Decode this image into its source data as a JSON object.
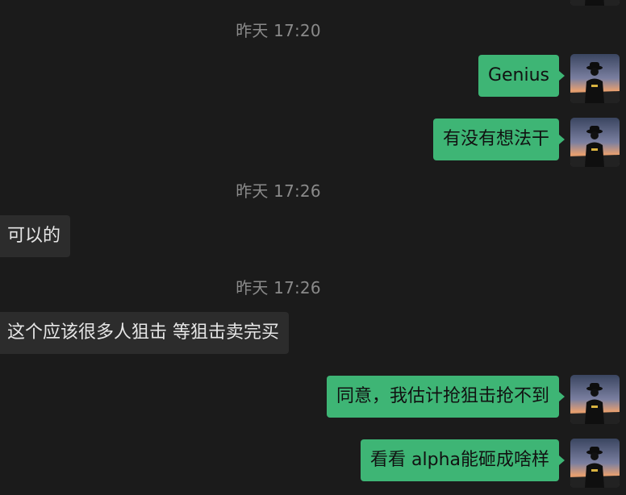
{
  "chat": {
    "timestamps": [
      "昨天 17:20",
      "昨天 17:26",
      "昨天 17:26"
    ],
    "messages": [
      {
        "direction": "outgoing",
        "text": "Genius"
      },
      {
        "direction": "outgoing",
        "text": "有没有想法干"
      },
      {
        "direction": "incoming",
        "text": "可以的"
      },
      {
        "direction": "incoming",
        "text": "这个应该很多人狙击 等狙击卖完买"
      },
      {
        "direction": "outgoing",
        "text": "同意，我估计抢狙击抢不到"
      },
      {
        "direction": "outgoing",
        "text": "看看 alpha能砸成啥样"
      }
    ]
  },
  "colors": {
    "background": "#1b1b1b",
    "outgoing_bubble": "#3eb575",
    "incoming_bubble": "#2c2c2c",
    "timestamp_text": "#8a8a8a"
  },
  "icons": {
    "avatar": "user-avatar-silhouette-sunset"
  }
}
